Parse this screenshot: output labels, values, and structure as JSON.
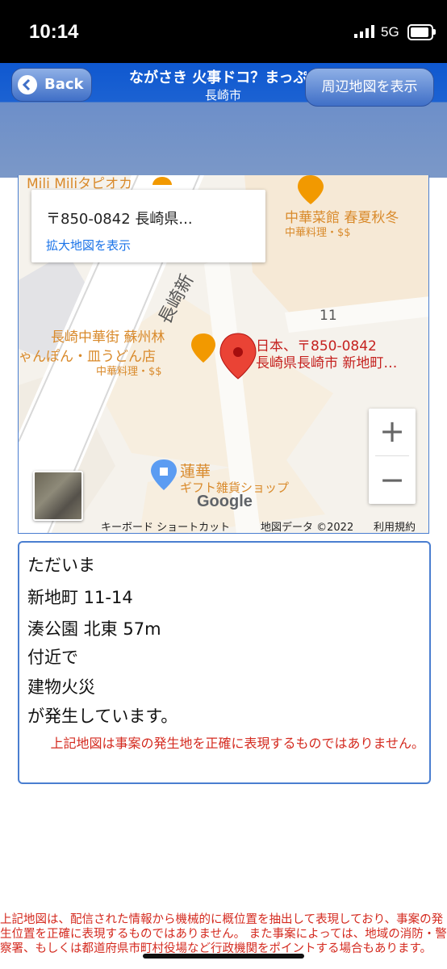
{
  "status_bar": {
    "time": "10:14",
    "network": "5G"
  },
  "nav": {
    "back_label": "Back",
    "title": "ながさき 火事ドコ？まっぷ",
    "subtitle": "長崎市",
    "map_button_label": "周辺地図を表示"
  },
  "map": {
    "info_card": {
      "address": "〒850-0842 長崎県...",
      "link": "拡大地図を表示"
    },
    "pin_label_line1": "日本、〒850-0842",
    "pin_label_line2": "長崎県長崎市 新地町…",
    "road_name": "長崎新",
    "block_number": "11",
    "poi_top_partial": "Mili Miliタピオカ",
    "poi_restaurant1_name": "中華菜館 春夏秋冬",
    "poi_restaurant1_sub": "中華料理・$$",
    "poi_restaurant2_name1": "長崎中華街 蘇州林",
    "poi_restaurant2_name2": "ゃんぽん・皿うどん店",
    "poi_restaurant2_sub": "中華料理・$$",
    "poi_shop_name": "蓮華",
    "poi_shop_sub": "ギフト雑貨ショップ",
    "google_logo": "Google",
    "attribution": {
      "keyboard": "キーボード ショートカット",
      "data": "地図データ ©2022",
      "terms": "利用規約"
    },
    "zoom_in": "+",
    "zoom_out": "−"
  },
  "message": {
    "line1": "ただいま",
    "line2": "新地町 11-14",
    "line3": "湊公園 北東 57m",
    "line4": "付近で",
    "line5": "建物火災",
    "line6": "が発生しています。",
    "note": "上記地図は事案の発生地を正確に表現するものではありません。"
  },
  "disclaimer": "上記地図は、配信された情報から機械的に概位置を抽出して表現しており、事案の発生位置を正確に表現するものではありません。 また事案によっては、地域の消防・警察署、もしくは都道府県市町村役場など行政機関をポイントする場合もあります。",
  "colors": {
    "nav_blue": "#1c62d2",
    "pin_red": "#ea4335",
    "poi_orange": "#d98a2b",
    "note_red": "#d42a1f",
    "frame_blue": "#4a7ed0"
  }
}
